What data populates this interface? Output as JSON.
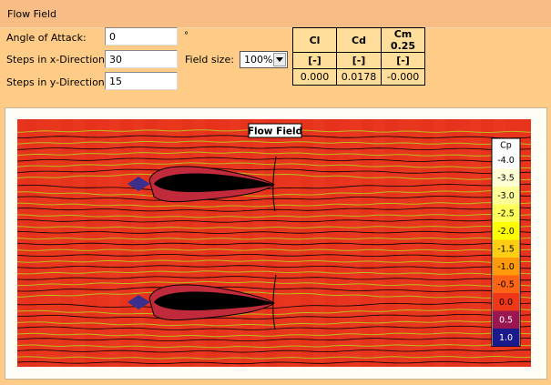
{
  "window": {
    "title": "Flow Field"
  },
  "form": {
    "angle_label": "Angle of Attack:",
    "angle_value": "0",
    "angle_unit": "°",
    "steps_x_label": "Steps in x-Direction:",
    "steps_x_value": "30",
    "steps_y_label": "Steps in y-Direction:",
    "steps_y_value": "15",
    "field_size_label": "Field size:",
    "field_size_value": "100%"
  },
  "coefficients": {
    "headers": [
      "Cl",
      "Cd",
      "Cm 0.25"
    ],
    "units": [
      "[-]",
      "[-]",
      "[-]"
    ],
    "values": [
      "0.000",
      "0.0178",
      "-0.000"
    ]
  },
  "plot": {
    "title": "Flow Field",
    "colors": {
      "background": "#e8341c",
      "near_body": "#c02a3a",
      "streamline": "#bcbc1c",
      "isoline": "#000000",
      "airfoil": "#000000",
      "leading_edge": "#3b2e8c"
    },
    "legend": {
      "title": "Cp",
      "entries": [
        {
          "label": "-4.0",
          "color": "#ffffff",
          "text": "#000000"
        },
        {
          "label": "-3.5",
          "color": "#ffffd4",
          "text": "#000000"
        },
        {
          "label": "-3.0",
          "color": "#ffff9a",
          "text": "#000000"
        },
        {
          "label": "-2.5",
          "color": "#ffff5a",
          "text": "#000000"
        },
        {
          "label": "-2.0",
          "color": "#ffff00",
          "text": "#000000"
        },
        {
          "label": "-1.5",
          "color": "#ffce14",
          "text": "#000000"
        },
        {
          "label": "-1.0",
          "color": "#ff9a0c",
          "text": "#000000"
        },
        {
          "label": "-0.5",
          "color": "#ff6414",
          "text": "#000000"
        },
        {
          "label": "0.0",
          "color": "#ee3818",
          "text": "#000000"
        },
        {
          "label": "0.5",
          "color": "#9a1650",
          "text": "#ffffff"
        },
        {
          "label": "1.0",
          "color": "#1a1a8c",
          "text": "#ffffff"
        }
      ]
    }
  }
}
